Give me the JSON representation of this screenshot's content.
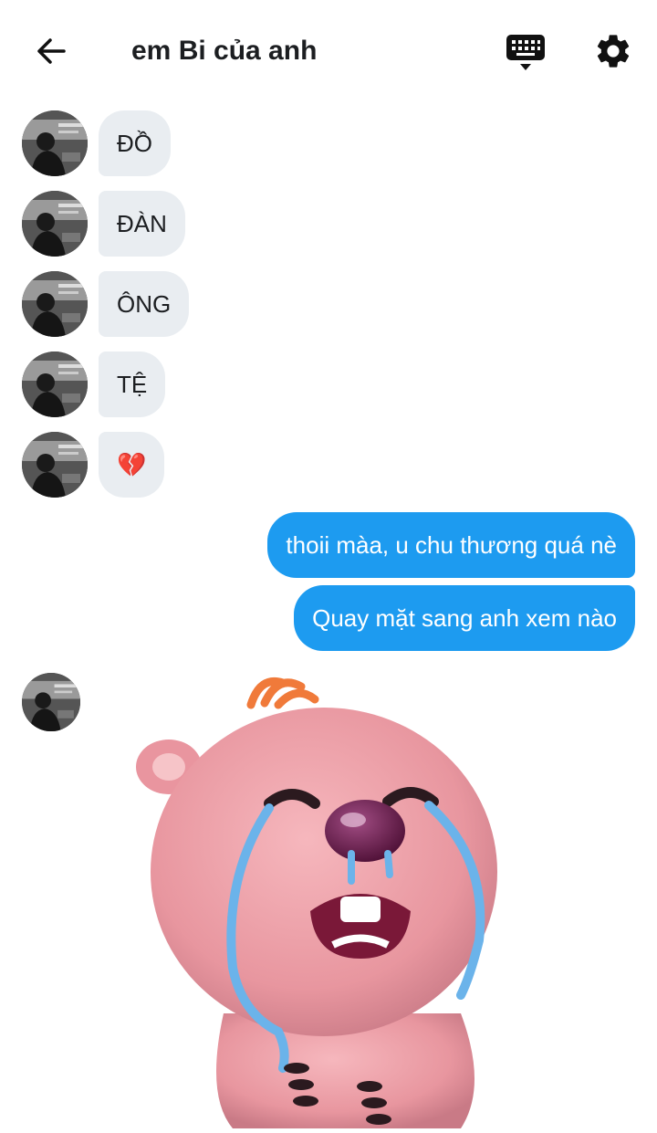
{
  "header": {
    "title": "em Bi của anh",
    "back_icon": "arrow-left-icon",
    "keyboard_icon": "keyboard-icon",
    "settings_icon": "gear-icon"
  },
  "messages_in": [
    {
      "text": "ĐỒ"
    },
    {
      "text": "ĐÀN"
    },
    {
      "text": "ÔNG"
    },
    {
      "text": "TỆ"
    },
    {
      "text": "💔"
    }
  ],
  "messages_out": [
    {
      "text": "thoii màa, u chu thương quá nè"
    },
    {
      "text": "Quay mặt sang anh xem nào"
    }
  ],
  "sticker": {
    "description_icon": "crying-beaver-sticker"
  },
  "colors": {
    "outgoing_bubble": "#1d9bf0",
    "incoming_bubble": "#e9edf1"
  }
}
